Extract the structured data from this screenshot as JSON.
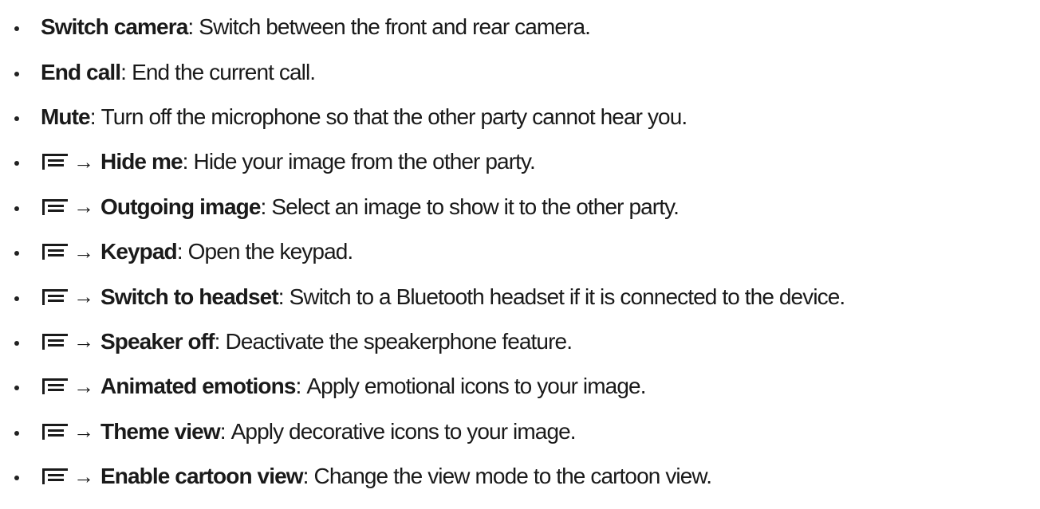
{
  "arrow_glyph": "→",
  "separator": ":",
  "items": [
    {
      "menu": false,
      "label": "Switch camera",
      "description": "Switch between the front and rear camera."
    },
    {
      "menu": false,
      "label": "End call",
      "description": "End the current call."
    },
    {
      "menu": false,
      "label": "Mute",
      "description": "Turn off the microphone so that the other party cannot hear you."
    },
    {
      "menu": true,
      "label": "Hide me",
      "description": "Hide your image from the other party."
    },
    {
      "menu": true,
      "label": "Outgoing image",
      "description": "Select an image to show it to the other party."
    },
    {
      "menu": true,
      "label": "Keypad",
      "description": "Open the keypad."
    },
    {
      "menu": true,
      "label": "Switch to headset",
      "description": "Switch to a Bluetooth headset if it is connected to the device."
    },
    {
      "menu": true,
      "label": "Speaker off",
      "description": "Deactivate the speakerphone feature."
    },
    {
      "menu": true,
      "label": "Animated emotions",
      "description": "Apply emotional icons to your image."
    },
    {
      "menu": true,
      "label": "Theme view",
      "description": "Apply decorative icons to your image."
    },
    {
      "menu": true,
      "label": "Enable cartoon view",
      "description": "Change the view mode to the cartoon view."
    }
  ]
}
